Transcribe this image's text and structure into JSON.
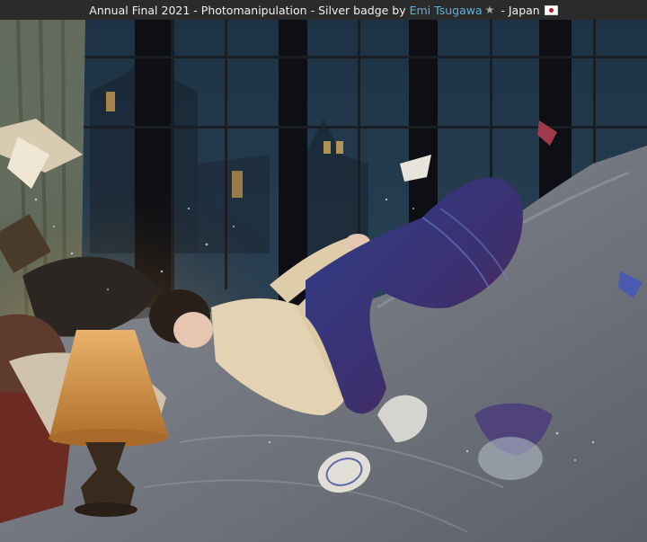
{
  "caption": {
    "competition": "Annual Final 2021",
    "sep1": " - ",
    "category": "Photomanipulation",
    "sep2": " - ",
    "award": "Silver badge",
    "by": " by ",
    "author": "Emi Tsugawa",
    "sep3": " - ",
    "country": "Japan",
    "star_icon": "star-icon",
    "flag_icon": "japan-flag-icon"
  },
  "colors": {
    "caption_bg": "#2b2b2b",
    "caption_text": "#f0f0f0",
    "author_link": "#5fb0d8",
    "flag_red": "#c8102e"
  }
}
